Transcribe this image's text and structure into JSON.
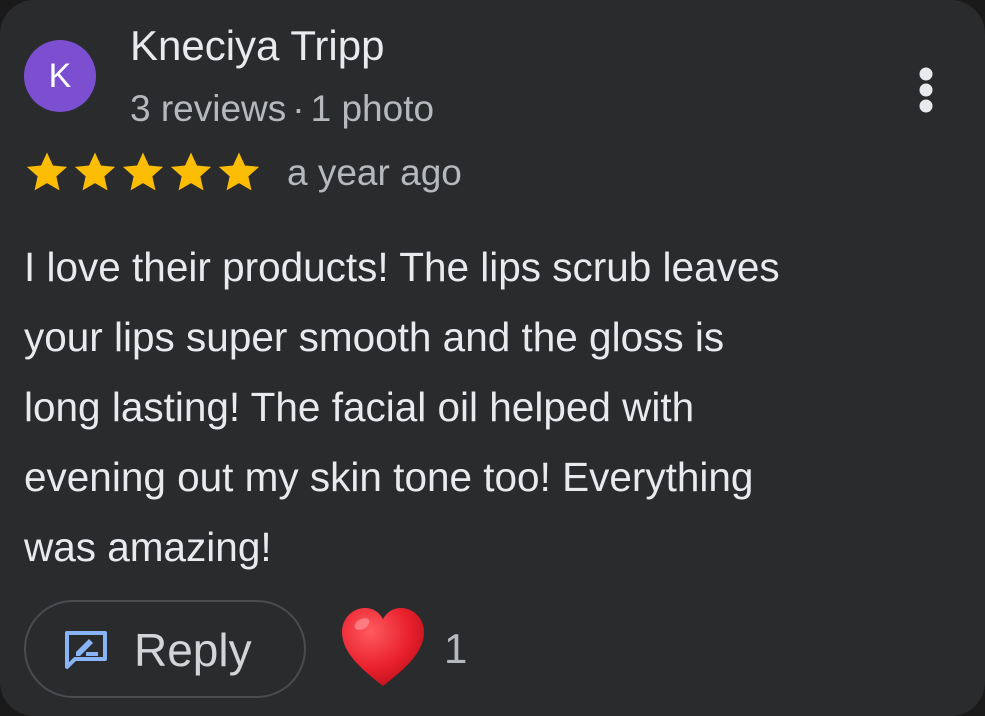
{
  "review": {
    "avatar_letter": "K",
    "avatar_color": "#7b4fcf",
    "reviewer_name": "Kneciya Tripp",
    "reviews_count": "3 reviews",
    "separator": "·",
    "photos_count": "1 photo",
    "rating": 5,
    "rating_max": 5,
    "time_ago": "a year ago",
    "text_lines": [
      "I love their products! The lips scrub leaves",
      "your lips super smooth and the gloss is",
      "long lasting! The facial oil helped with",
      "evening out my skin tone too! Everything",
      "was amazing!"
    ],
    "more_icon": "more-vert-icon"
  },
  "actions": {
    "reply_label": "Reply",
    "reply_icon": "rate-review-icon",
    "reaction_icon": "red-heart-icon",
    "reaction_count": "1"
  },
  "colors": {
    "card_background": "#2a2b2d",
    "star": "#fbbc04",
    "reply_icon": "#8ab4f8",
    "heart": "#e8202c"
  }
}
